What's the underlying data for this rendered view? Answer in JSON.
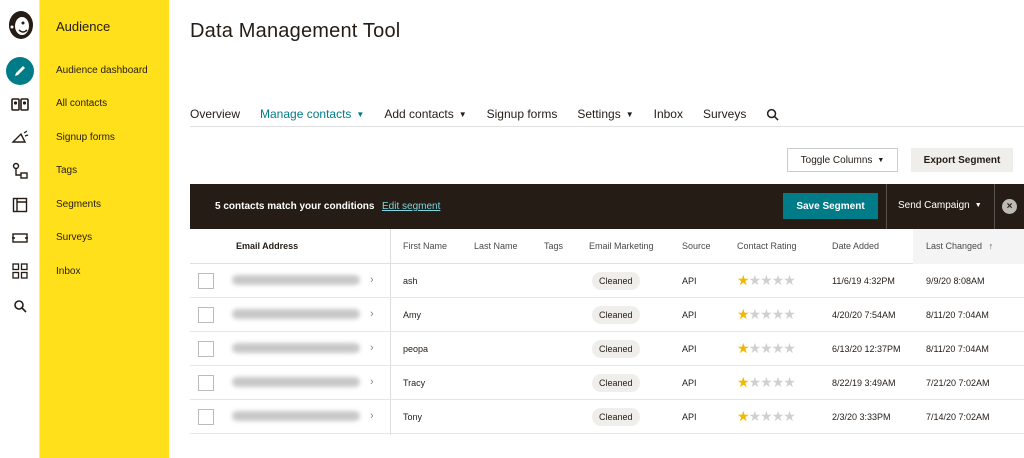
{
  "subnav": {
    "title": "Audience",
    "items": [
      "Audience dashboard",
      "All contacts",
      "Signup forms",
      "Tags",
      "Segments",
      "Surveys",
      "Inbox"
    ]
  },
  "page_title": "Data Management Tool",
  "tabs": [
    {
      "label": "Overview",
      "dropdown": false
    },
    {
      "label": "Manage contacts",
      "dropdown": true
    },
    {
      "label": "Add contacts",
      "dropdown": true
    },
    {
      "label": "Signup forms",
      "dropdown": false
    },
    {
      "label": "Settings",
      "dropdown": true
    },
    {
      "label": "Inbox",
      "dropdown": false
    },
    {
      "label": "Surveys",
      "dropdown": false
    }
  ],
  "toolbar": {
    "toggle_columns": "Toggle Columns",
    "export_segment": "Export Segment"
  },
  "segment_bar": {
    "match_text": "5 contacts match your conditions",
    "edit_link": "Edit segment",
    "save_label": "Save Segment",
    "send_label": "Send Campaign",
    "close_glyph": "×"
  },
  "table": {
    "headers": {
      "email": "Email Address",
      "first_name": "First Name",
      "last_name": "Last Name",
      "tags": "Tags",
      "email_marketing": "Email Marketing",
      "source": "Source",
      "contact_rating": "Contact Rating",
      "date_added": "Date Added",
      "last_changed": "Last Changed",
      "sort_glyph": "↑"
    },
    "rows": [
      {
        "first_name": "ash",
        "marketing": "Cleaned",
        "source": "API",
        "rating": 1,
        "date_added": "11/6/19 4:32PM",
        "last_changed": "9/9/20 8:08AM"
      },
      {
        "first_name": "Amy",
        "marketing": "Cleaned",
        "source": "API",
        "rating": 1,
        "date_added": "4/20/20 7:54AM",
        "last_changed": "8/11/20 7:04AM"
      },
      {
        "first_name": "peopa",
        "marketing": "Cleaned",
        "source": "API",
        "rating": 1,
        "date_added": "6/13/20 12:37PM",
        "last_changed": "8/11/20 7:04AM"
      },
      {
        "first_name": "Tracy",
        "marketing": "Cleaned",
        "source": "API",
        "rating": 1,
        "date_added": "8/22/19 3:49AM",
        "last_changed": "7/21/20 7:02AM"
      },
      {
        "first_name": "Tony",
        "marketing": "Cleaned",
        "source": "API",
        "rating": 1,
        "date_added": "2/3/20 3:33PM",
        "last_changed": "7/14/20 7:02AM"
      }
    ],
    "rating_max": 5
  },
  "colors": {
    "accent": "#007c89",
    "brand_yellow": "#ffe01b",
    "dark_bar": "#241c15",
    "star": "#f2b705"
  }
}
